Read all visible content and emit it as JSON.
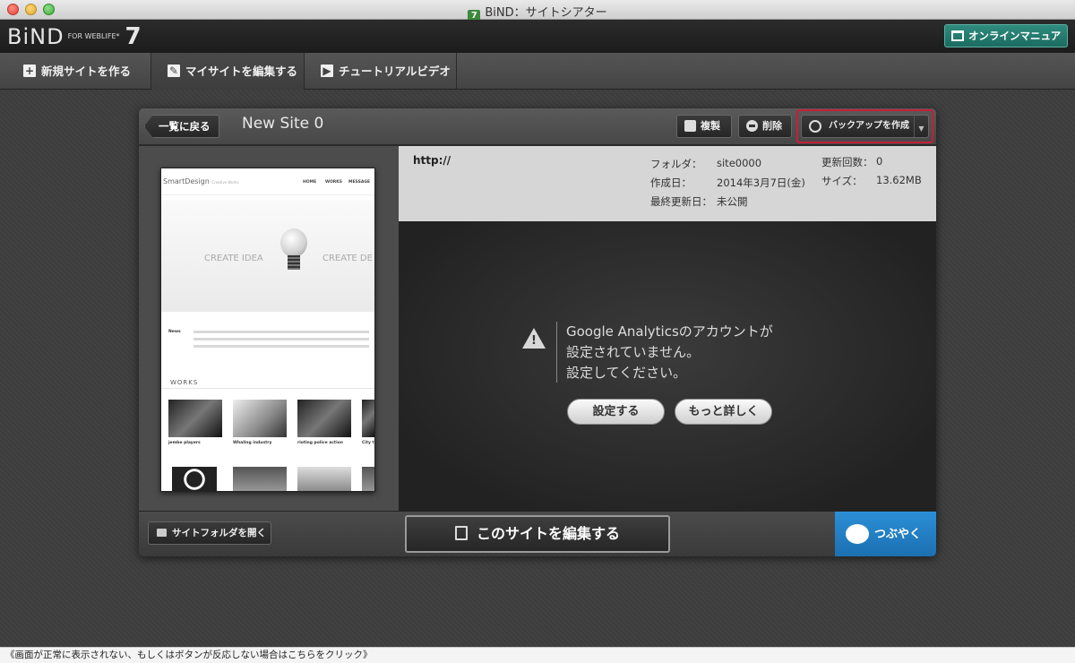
{
  "window": {
    "title": "BiND：サイトシアター",
    "app_badge": "7"
  },
  "header": {
    "logo_main": "BiND",
    "logo_sub": "FOR WEBLIFE*",
    "logo_version": "7",
    "manual_label": "オンラインマニュアル"
  },
  "nav": {
    "items": [
      {
        "label": "新規サイトを作る",
        "icon": "plus-icon"
      },
      {
        "label": "マイサイトを編集する",
        "icon": "pencil-icon"
      },
      {
        "label": "チュートリアルビデオ",
        "icon": "play-icon"
      }
    ]
  },
  "toolbar": {
    "back_label": "一覧に戻る",
    "site_title": "New Site 0",
    "duplicate_label": "複製",
    "delete_label": "削除",
    "backup_label": "バックアップを作成"
  },
  "thumbnail": {
    "logo": "SmartDesign",
    "logo_sub": "Creative Works",
    "nav": [
      "HOME",
      "WORKS",
      "MESSAGE"
    ],
    "hero_left": "CREATE IDEA",
    "hero_right": "CREATE DE",
    "news_title": "News",
    "works_title": "WORKS",
    "captions": [
      "jembe players",
      "Whaling industry",
      "rioting police action",
      "City t"
    ]
  },
  "info": {
    "url": "http://",
    "folder_label": "フォルダ：",
    "folder_value": "site0000",
    "created_label": "作成日：",
    "created_value": "2014年3月7日(金)",
    "updated_label": "最終更新日：",
    "updated_value": "未公開",
    "update_count_label": "更新回数：",
    "update_count_value": "0",
    "size_label": "サイズ：",
    "size_value": "13.62MB"
  },
  "analytics": {
    "message_line1": "Google Analyticsのアカウントが",
    "message_line2": "設定されていません。",
    "message_line3": "設定してください。",
    "setup_label": "設定する",
    "more_label": "もっと詳しく"
  },
  "bottom": {
    "open_folder_label": "サイトフォルダを開く",
    "edit_site_label": "このサイトを編集する",
    "tweet_label": "つぶやく"
  },
  "status": {
    "text": "《画面が正常に表示されない、もしくはボタンが反応しない場合はこちらをクリック》"
  }
}
